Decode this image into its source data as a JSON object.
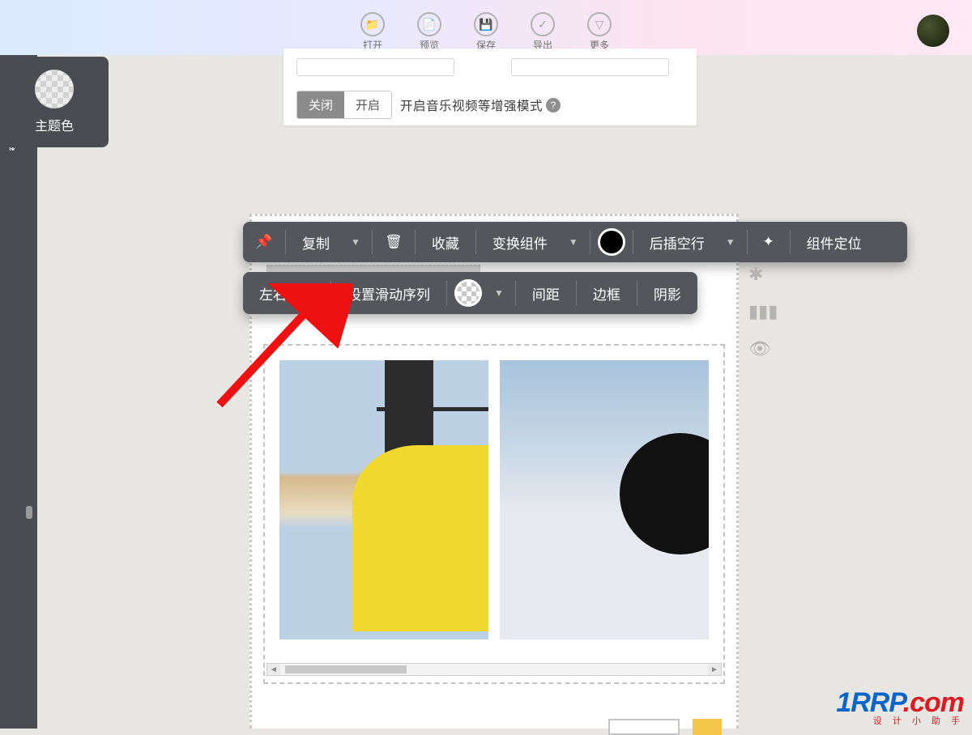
{
  "topbar": {
    "items": [
      {
        "label": "打开",
        "icon": "folder-icon"
      },
      {
        "label": "预览",
        "icon": "doc-icon"
      },
      {
        "label": "保存",
        "icon": "save-icon"
      },
      {
        "label": "导出",
        "icon": "export-icon"
      },
      {
        "label": "更多",
        "icon": "more-icon"
      }
    ]
  },
  "sidebar": {
    "hot_tab": "热门",
    "theme_color_label": "主题色"
  },
  "settings": {
    "toggle_off": "关闭",
    "toggle_on": "开启",
    "hint": "开启音乐视频等增强模式"
  },
  "toolbar_main": {
    "copy": "复制",
    "favorite": "收藏",
    "transform": "变换组件",
    "insert_after": "后插空行",
    "locate": "组件定位"
  },
  "toolbar_sub": {
    "slide_lr": "左右滑动",
    "set_sequence": "设置滑动序列",
    "spacing": "间距",
    "border": "边框",
    "shadow": "阴影"
  },
  "watermark": {
    "text1": "1RRP",
    "text2": ".com",
    "sub": "设 计 小 助 手"
  },
  "icon_glyphs": {
    "folder-icon": "📁",
    "doc-icon": "📄",
    "save-icon": "💾",
    "export-icon": "✓",
    "more-icon": "▽"
  }
}
